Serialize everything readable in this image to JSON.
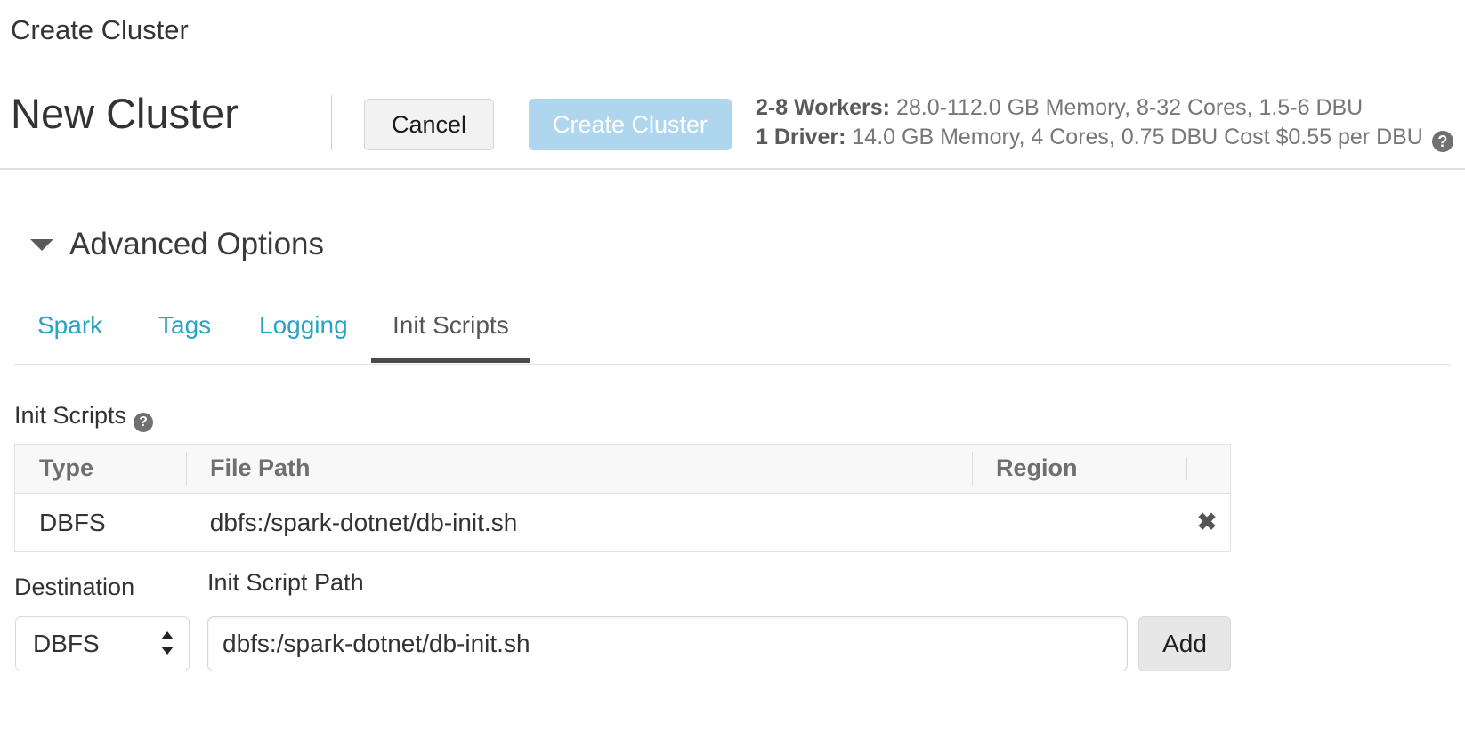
{
  "breadcrumb": {
    "label": "Create Cluster"
  },
  "header": {
    "cluster_name": "New Cluster",
    "cancel_label": "Cancel",
    "create_label": "Create Cluster",
    "create_button_color": "#aed6ef",
    "specs": {
      "workers_label": "2-8 Workers:",
      "workers_detail": " 28.0-112.0 GB Memory, 8-32 Cores, 1.5-6 DBU",
      "driver_label": "1 Driver:",
      "driver_detail": " 14.0 GB Memory, 4 Cores, 0.75 DBU Cost $0.55 per DBU",
      "help_glyph": "?"
    }
  },
  "advanced_options": {
    "title": "Advanced Options",
    "expanded": true,
    "caret_icon": "caret-down-icon"
  },
  "tabs": {
    "items": [
      {
        "label": "Spark",
        "active": false
      },
      {
        "label": "Tags",
        "active": false
      },
      {
        "label": "Logging",
        "active": false
      },
      {
        "label": "Init Scripts",
        "active": true
      }
    ],
    "active_color": "#4a4a4a",
    "link_color": "#2aa3c4"
  },
  "init_scripts": {
    "section_label": "Init Scripts",
    "help_glyph": "?",
    "table": {
      "columns": [
        "Type",
        "File Path",
        "Region"
      ],
      "rows": [
        {
          "type": "DBFS",
          "file_path": "dbfs:/spark-dotnet/db-init.sh",
          "region": "",
          "delete_glyph": "✖"
        }
      ]
    },
    "form": {
      "destination_label": "Destination",
      "destination_value": "DBFS",
      "path_label": "Init Script Path",
      "path_value": "dbfs:/spark-dotnet/db-init.sh",
      "path_placeholder": "",
      "add_label": "Add"
    }
  }
}
